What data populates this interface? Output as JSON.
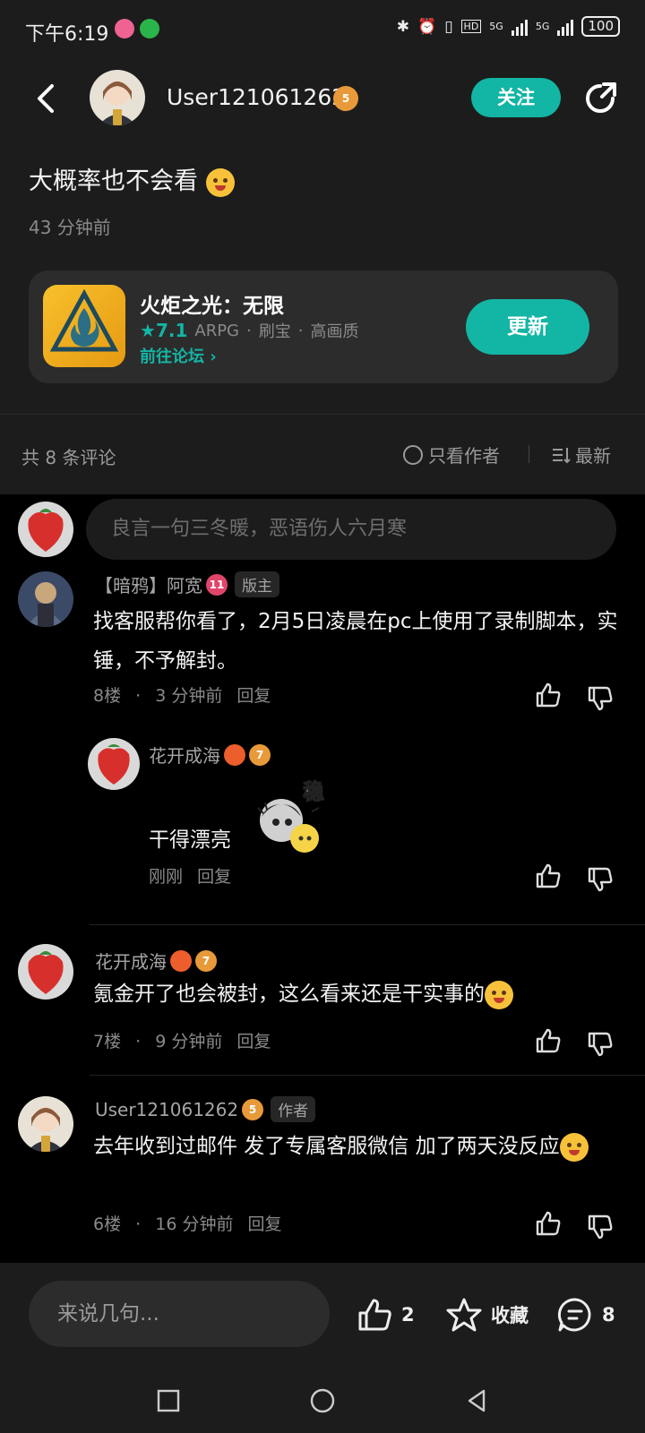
{
  "status": {
    "time": "下午6:19",
    "icons": [
      "bluetooth-icon",
      "alarm-icon",
      "vibrate-icon",
      "hd-icon",
      "signal-5g-icon",
      "signal-5g-icon"
    ],
    "network_1": "5G",
    "network_2": "5G",
    "battery": "100"
  },
  "header": {
    "username": "User121061262",
    "level": "5",
    "follow_label": "关注"
  },
  "post": {
    "text": "大概率也不会看",
    "time": "43 分钟前",
    "game": {
      "name": "火炬之光：无限",
      "rating": "7.1",
      "genre": "ARPG",
      "tag1": "刷宝",
      "tag2": "高画质",
      "forum_link": "前往论坛 ›",
      "update_label": "更新"
    }
  },
  "comments_bar": {
    "count": "共 8 条评论",
    "only_author": "只看作者",
    "sort": "最新"
  },
  "comment_input": {
    "placeholder": "良言一句三冬暖，恶语伤人六月寒"
  },
  "comments": [
    {
      "name": "【暗鸦】阿宽",
      "level": "11",
      "tag": "版主",
      "body": "找客服帮你看了，2月5日凌晨在pc上使用了录制脚本，实锤，不予解封。",
      "floor": "8楼",
      "time": "3 分钟前",
      "reply": "回复"
    },
    {
      "name": "花开成海",
      "level": "7",
      "body": "干得漂亮",
      "time": "刚刚",
      "reply": "回复",
      "sticker_text": "稳"
    },
    {
      "name": "花开成海",
      "level": "7",
      "body": "氪金开了也会被封，这么看来还是干实事的",
      "floor": "7楼",
      "time": "9 分钟前",
      "reply": "回复"
    },
    {
      "name": "User121061262",
      "level": "5",
      "tag": "作者",
      "body": "去年收到过邮件 发了专属客服微信 加了两天没反应",
      "floor": "6楼",
      "time": "16 分钟前",
      "reply": "回复"
    }
  ],
  "bottom": {
    "reply_placeholder": "来说几句...",
    "likes": "2",
    "favorite": "收藏",
    "comments": "8"
  },
  "colors": {
    "accent": "#13b5a4",
    "background": "#000000",
    "surface": "#1c1c1c",
    "card": "#2c2c2c"
  }
}
